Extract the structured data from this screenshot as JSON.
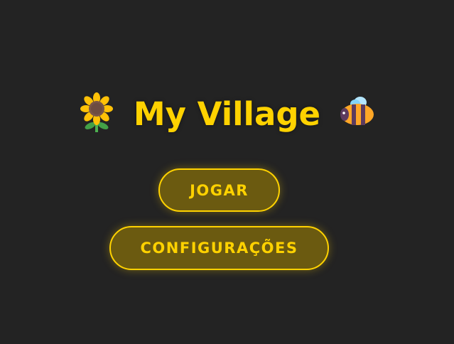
{
  "title": {
    "text": "My Village",
    "left_icon": "sunflower-icon",
    "right_icon": "bee-icon"
  },
  "menu": {
    "play_label": "JOGAR",
    "settings_label": "CONFIGURAÇÕES"
  },
  "colors": {
    "background": "#232323",
    "accent": "#ffd200",
    "button_fill": "#6b5a10"
  }
}
